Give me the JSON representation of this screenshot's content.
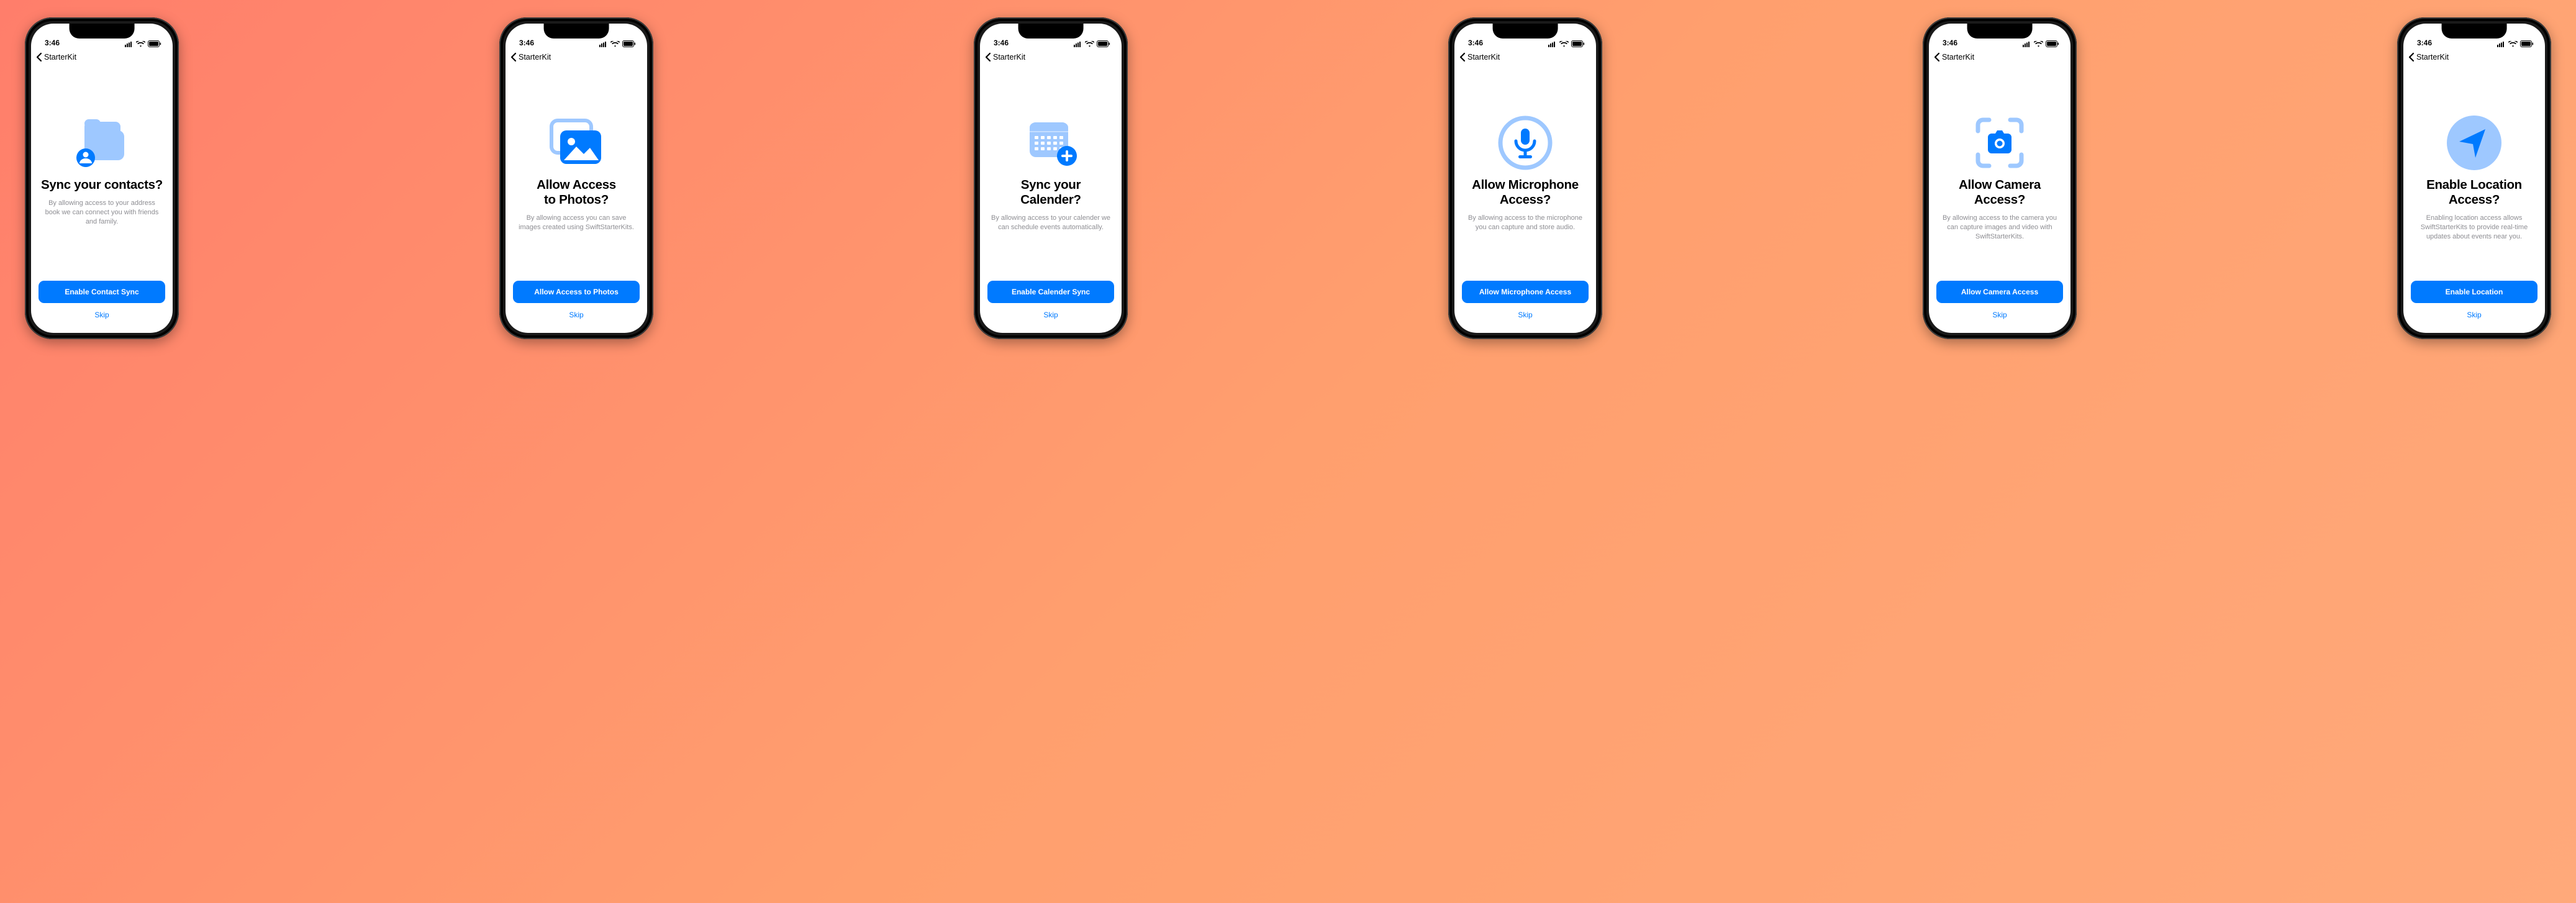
{
  "status": {
    "time": "3:46"
  },
  "nav": {
    "back_label": "StarterKit"
  },
  "screens": [
    {
      "icon": "contacts",
      "title": "Sync your contacts?",
      "body": "By allowing access to your address book we can connect you with friends and family.",
      "primary": "Enable Contact Sync",
      "skip": "Skip"
    },
    {
      "icon": "photos",
      "title": "Allow Access\nto Photos?",
      "body": "By allowing access you can save images created using SwiftStarterKits.",
      "primary": "Allow Access to Photos",
      "skip": "Skip"
    },
    {
      "icon": "calendar",
      "title": "Sync your\nCalender?",
      "body": "By allowing access to your calender we can schedule events automatically.",
      "primary": "Enable Calender Sync",
      "skip": "Skip"
    },
    {
      "icon": "microphone",
      "title": "Allow Microphone\nAccess?",
      "body": "By allowing access to the microphone you can capture and store audio.",
      "primary": "Allow Microphone Access",
      "skip": "Skip"
    },
    {
      "icon": "camera",
      "title": "Allow Camera\nAccess?",
      "body": "By allowing access to the camera you can capture images and video with SwiftStarterKits.",
      "primary": "Allow Camera Access",
      "skip": "Skip"
    },
    {
      "icon": "location",
      "title": "Enable Location\nAccess?",
      "body": "Enabling location access allows SwiftStarterKits to provide real-time updates about events near you.",
      "primary": "Enable Location",
      "skip": "Skip"
    }
  ]
}
